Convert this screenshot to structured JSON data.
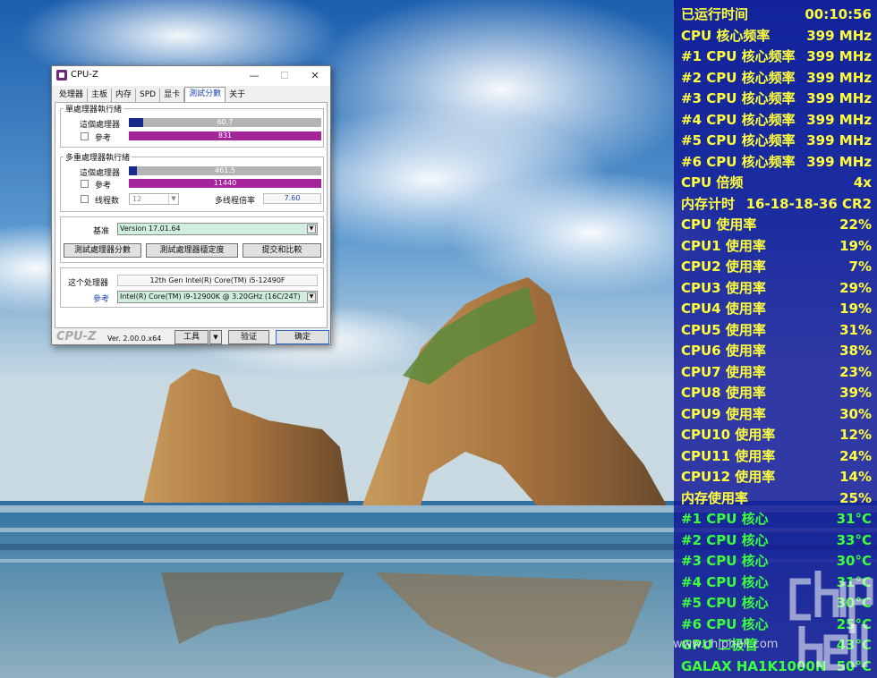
{
  "cpuz": {
    "title": "CPU-Z",
    "window_controls": {
      "minimize": "—",
      "maximize": "☐",
      "close": "✕"
    },
    "tabs": [
      "处理器",
      "主板",
      "内存",
      "SPD",
      "显卡",
      "測試分數",
      "关于"
    ],
    "active_tab": "測試分數",
    "single_thread": {
      "title": "單處理器執行緒",
      "this_label": "這個處理器",
      "this_score": "60.7",
      "this_fraction": 0.073,
      "ref_label": "參考",
      "ref_score": "831",
      "ref_fraction": 1.0
    },
    "multi_thread": {
      "title": "多重處理器執行緒",
      "this_label": "這個處理器",
      "this_score": "461.5",
      "this_fraction": 0.04,
      "ref_label": "參考",
      "ref_score": "11440",
      "ref_fraction": 1.0,
      "threads_label": "线程数",
      "threads_value": "12",
      "ratio_label": "多线程倍率",
      "ratio_value": "7.60"
    },
    "baseline_label": "基准",
    "baseline_value": "Version 17.01.64",
    "buttons": {
      "bench_cpu": "測試處理器分數",
      "stress_cpu": "測試處理器穩定度",
      "submit": "提交和比較"
    },
    "this_proc_label": "这个处理器",
    "this_proc_value": "12th Gen Intel(R) Core(TM) i5-12490F",
    "ref_proc_label": "參考",
    "ref_proc_value": "Intel(R) Core(TM) i9-12900K @ 3.20GHz (16C/24T)",
    "footer": {
      "logo": "CPU-Z",
      "version": "Ver. 2.00.0.x64",
      "tools": "工具",
      "validate": "验证",
      "ok": "确定"
    }
  },
  "osd": {
    "rows": [
      {
        "label": "已运行时间",
        "value": "00:10:56",
        "color": "#ffff3c"
      },
      {
        "label": "CPU 核心频率",
        "value": "399 MHz",
        "color": "#ffff3c"
      },
      {
        "label": "#1 CPU 核心频率",
        "value": "399 MHz",
        "color": "#ffff3c"
      },
      {
        "label": "#2 CPU 核心频率",
        "value": "399 MHz",
        "color": "#ffff3c"
      },
      {
        "label": "#3 CPU 核心频率",
        "value": "399 MHz",
        "color": "#ffff3c"
      },
      {
        "label": "#4 CPU 核心频率",
        "value": "399 MHz",
        "color": "#ffff3c"
      },
      {
        "label": "#5 CPU 核心频率",
        "value": "399 MHz",
        "color": "#ffff3c"
      },
      {
        "label": "#6 CPU 核心频率",
        "value": "399 MHz",
        "color": "#ffff3c"
      },
      {
        "label": "CPU 倍频",
        "value": "4x",
        "color": "#ffff3c"
      },
      {
        "label": "内存计时",
        "value": "16-18-18-36 CR2",
        "color": "#ffff3c"
      },
      {
        "label": "CPU 使用率",
        "value": "22%",
        "color": "#ffff3c"
      },
      {
        "label": "CPU1 使用率",
        "value": "19%",
        "color": "#ffff3c"
      },
      {
        "label": "CPU2 使用率",
        "value": "7%",
        "color": "#ffff3c"
      },
      {
        "label": "CPU3 使用率",
        "value": "29%",
        "color": "#ffff3c"
      },
      {
        "label": "CPU4 使用率",
        "value": "19%",
        "color": "#ffff3c"
      },
      {
        "label": "CPU5 使用率",
        "value": "31%",
        "color": "#ffff3c"
      },
      {
        "label": "CPU6 使用率",
        "value": "38%",
        "color": "#ffff3c"
      },
      {
        "label": "CPU7 使用率",
        "value": "23%",
        "color": "#ffff3c"
      },
      {
        "label": "CPU8 使用率",
        "value": "39%",
        "color": "#ffff3c"
      },
      {
        "label": "CPU9 使用率",
        "value": "30%",
        "color": "#ffff3c"
      },
      {
        "label": "CPU10 使用率",
        "value": "12%",
        "color": "#ffff3c"
      },
      {
        "label": "CPU11 使用率",
        "value": "24%",
        "color": "#ffff3c"
      },
      {
        "label": "CPU12 使用率",
        "value": "14%",
        "color": "#ffff3c"
      },
      {
        "label": "内存使用率",
        "value": "25%",
        "color": "#ffff3c"
      },
      {
        "label": "#1 CPU 核心",
        "value": "31°C",
        "color": "#3cff3c"
      },
      {
        "label": "#2 CPU 核心",
        "value": "33°C",
        "color": "#3cff3c"
      },
      {
        "label": "#3 CPU 核心",
        "value": "30°C",
        "color": "#3cff3c"
      },
      {
        "label": "#4 CPU 核心",
        "value": "31°C",
        "color": "#3cff3c"
      },
      {
        "label": "#5 CPU 核心",
        "value": "30°C",
        "color": "#3cff3c"
      },
      {
        "label": "#6 CPU 核心",
        "value": "25°C",
        "color": "#3cff3c"
      },
      {
        "label": "GPU 二极管",
        "value": "43°C",
        "color": "#3cff3c"
      },
      {
        "label": "GALAX HA1K1000N",
        "value": "50°C",
        "color": "#3cff3c"
      }
    ]
  },
  "watermark": {
    "logo": "chip hell",
    "site": "www.chiphell.com"
  }
}
